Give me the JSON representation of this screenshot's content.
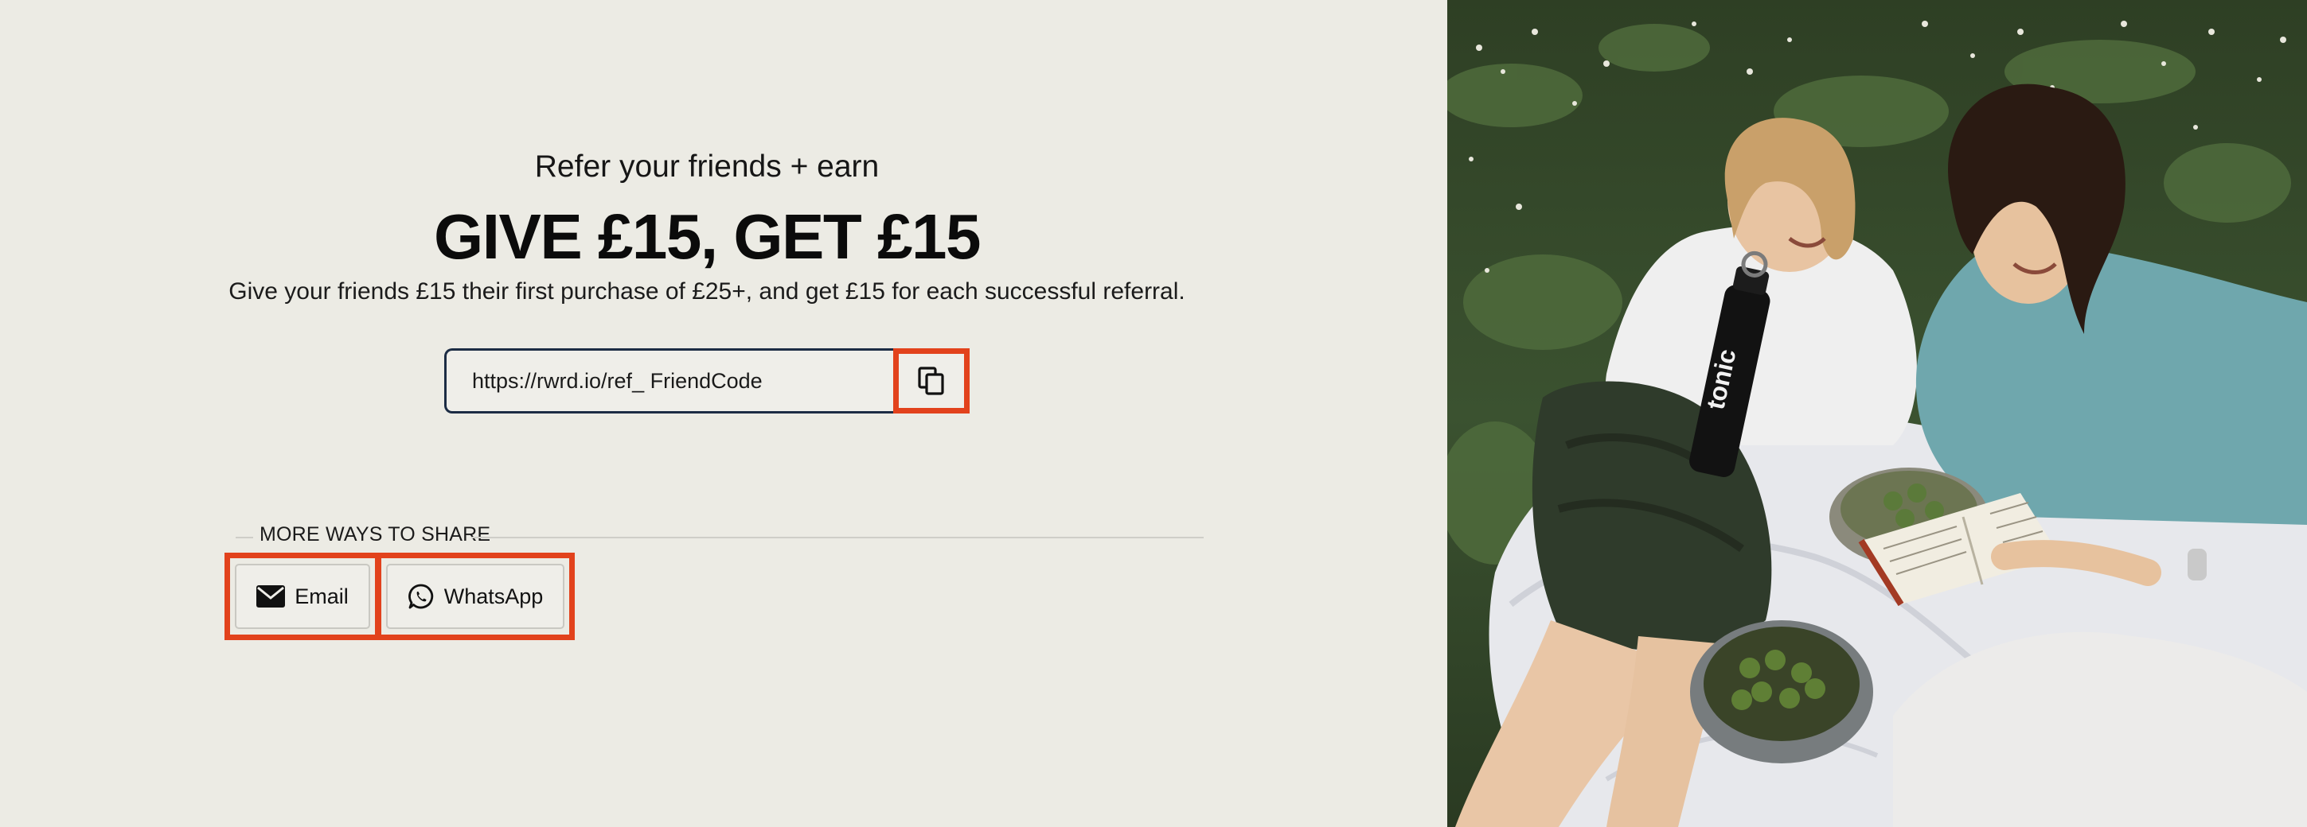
{
  "referral": {
    "subtitle": "Refer your friends + earn",
    "headline": "GIVE £15, GET £15",
    "description": "Give your friends £15 their first purchase of £25+, and get £15 for each successful referral.",
    "link_value": "https://rwrd.io/ref_ FriendCode"
  },
  "share": {
    "section_label": "MORE WAYS TO SHARE",
    "email_label": "Email",
    "whatsapp_label": "WhatsApp"
  },
  "icons": {
    "copy": "copy-icon",
    "email": "envelope-icon",
    "whatsapp": "whatsapp-icon"
  },
  "colors": {
    "background": "#ecebe4",
    "highlight": "#e2421c",
    "input_border": "#1c2c44"
  },
  "photo": {
    "bottle_text": "tonic"
  }
}
